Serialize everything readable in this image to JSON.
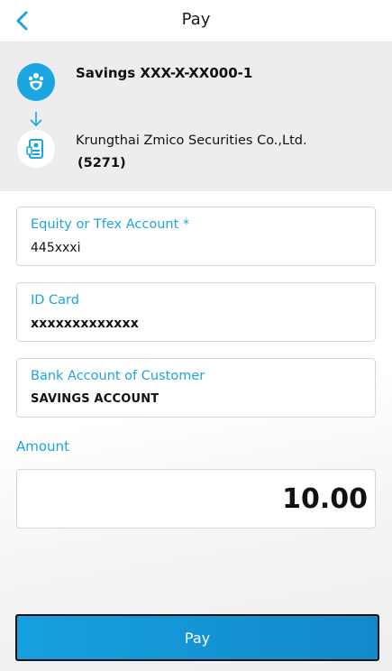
{
  "header": {
    "title": "Pay",
    "back_icon": "chevron-left-icon"
  },
  "transfer": {
    "from": {
      "account": "Savings XXX-X-XX000-1",
      "logo_icon": "bank-logo-icon"
    },
    "arrow_icon": "arrow-down-icon",
    "to": {
      "name": "Krungthai Zmico Securities Co.,Ltd.",
      "code": "(5271)",
      "logo_icon": "securities-logo-icon"
    }
  },
  "form": {
    "equity_account": {
      "label": "Equity or Tfex Account *",
      "value": "445xxxi"
    },
    "id_card": {
      "label": "ID Card",
      "value": "xxxxxxxxxxxxx"
    },
    "bank_account": {
      "label": "Bank Account of Customer",
      "value": "SAVINGS ACCOUNT"
    },
    "amount": {
      "label": "Amount",
      "value": "10.00"
    }
  },
  "actions": {
    "pay_label": "Pay"
  },
  "colors": {
    "accent": "#1ba5e1",
    "button_start": "#17a0de",
    "button_end": "#1289cb",
    "summary_bg": "#ededed"
  }
}
